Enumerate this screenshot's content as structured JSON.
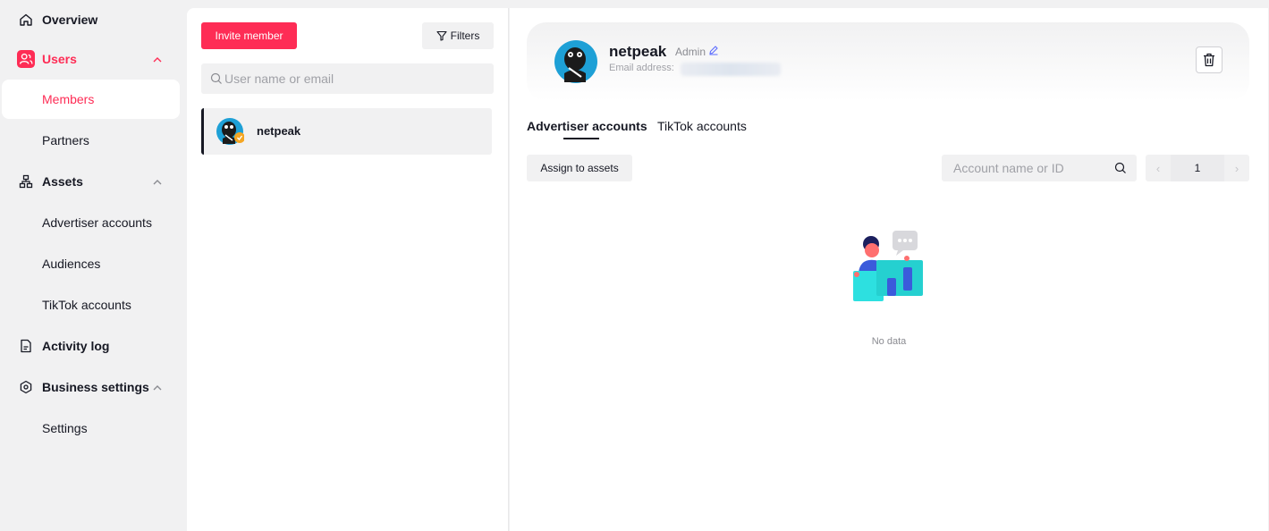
{
  "sidebar": {
    "items": [
      {
        "label": "Overview",
        "icon": "home-icon"
      },
      {
        "label": "Users",
        "icon": "users-icon"
      },
      {
        "label": "Members"
      },
      {
        "label": "Partners"
      },
      {
        "label": "Assets",
        "icon": "assets-icon"
      },
      {
        "label": "Advertiser accounts"
      },
      {
        "label": "Audiences"
      },
      {
        "label": "TikTok accounts"
      },
      {
        "label": "Activity log",
        "icon": "document-icon"
      },
      {
        "label": "Business settings",
        "icon": "settings-icon"
      },
      {
        "label": "Settings"
      }
    ]
  },
  "members": {
    "invite_label": "Invite member",
    "filters_label": "Filters",
    "search_placeholder": "User name or email",
    "list": [
      {
        "name": "netpeak"
      }
    ]
  },
  "profile": {
    "name": "netpeak",
    "role": "Admin",
    "email_label": "Email address:"
  },
  "tabs": [
    "Advertiser accounts",
    "TikTok accounts"
  ],
  "toolbar": {
    "assign_label": "Assign to assets",
    "search_placeholder": "Account name or ID",
    "page": "1"
  },
  "empty": {
    "text": "No data"
  },
  "colors": {
    "accent": "#fe2c55",
    "sidebar_bg": "#f1f1f2",
    "text": "#161823"
  }
}
